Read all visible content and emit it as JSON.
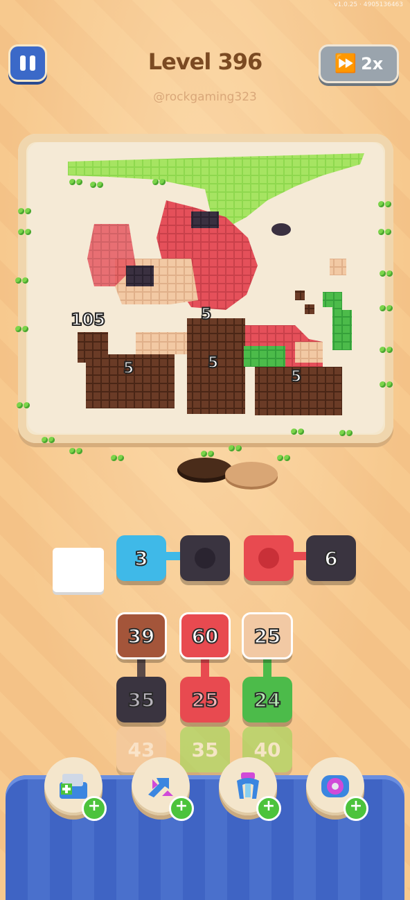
{
  "status_bar": {
    "version": "v1.0.25 · 4905136463"
  },
  "header": {
    "title": "Level 396",
    "subtitle": "@rockgaming323",
    "speed_label": "2x",
    "pause_icon": "pause-icon",
    "speed_icon": "fast-forward-icon"
  },
  "board": {
    "stack_counts": [
      "105",
      "5",
      "5",
      "5",
      "5"
    ],
    "colors": {
      "green": "#8ed84e",
      "red": "#e5505a",
      "dark_red": "#b84040",
      "brown": "#6a3b26",
      "peach": "#f2c9a4",
      "navy": "#3a3040",
      "light_green": "#4cbb4a"
    }
  },
  "queue": {
    "slots": [
      {
        "color": "#ffffff",
        "count": ""
      },
      {
        "color": "#3fb9e8",
        "count": "3"
      },
      {
        "color": "#3a3440",
        "count": ""
      },
      {
        "color": "#e84a50",
        "count": ""
      },
      {
        "color": "#3a3440",
        "count": "6"
      }
    ]
  },
  "stacks": {
    "columns": [
      {
        "tiles": [
          {
            "color": "#a4553a",
            "count": "39"
          },
          {
            "color": "#3a3440",
            "count": "35"
          },
          {
            "color": "#f2c9a4",
            "count": "43"
          }
        ]
      },
      {
        "tiles": [
          {
            "color": "#e84a50",
            "count": "60"
          },
          {
            "color": "#e84a50",
            "count": "25"
          },
          {
            "color": "#92d852",
            "count": "35"
          }
        ]
      },
      {
        "tiles": [
          {
            "color": "#f2c9a4",
            "count": "25"
          },
          {
            "color": "#4cbb4a",
            "count": "24"
          },
          {
            "color": "#92d852",
            "count": "40"
          }
        ]
      }
    ]
  },
  "boosters": [
    {
      "name": "add-slot-booster-icon"
    },
    {
      "name": "shuffle-booster-icon"
    },
    {
      "name": "magnet-booster-icon"
    },
    {
      "name": "spool-booster-icon"
    }
  ]
}
